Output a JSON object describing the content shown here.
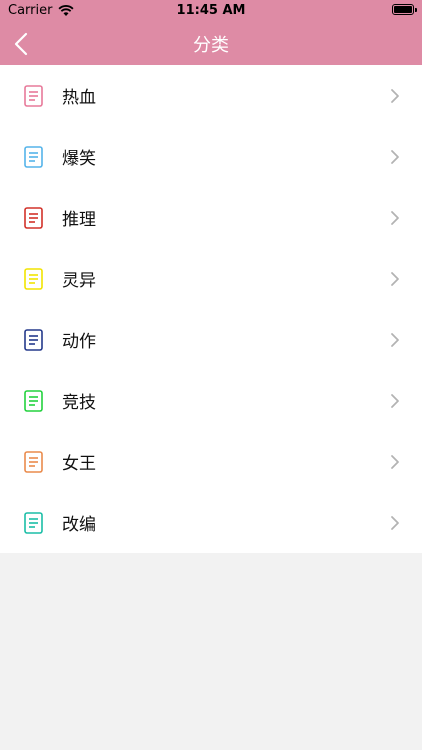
{
  "status": {
    "carrier": "Carrier",
    "time": "11:45 AM"
  },
  "nav": {
    "title": "分类"
  },
  "categories": [
    {
      "label": "热血",
      "color": "#e77a9a"
    },
    {
      "label": "爆笑",
      "color": "#55b4ea"
    },
    {
      "label": "推理",
      "color": "#d2322a"
    },
    {
      "label": "灵异",
      "color": "#f2e400"
    },
    {
      "label": "动作",
      "color": "#253a8c"
    },
    {
      "label": "竞技",
      "color": "#23d23e"
    },
    {
      "label": "女王",
      "color": "#ea8b4c"
    },
    {
      "label": "改编",
      "color": "#1cbea7"
    }
  ],
  "icons": {
    "back": "chevron-left-icon",
    "row": "document-icon",
    "disclosure": "chevron-right-icon"
  }
}
